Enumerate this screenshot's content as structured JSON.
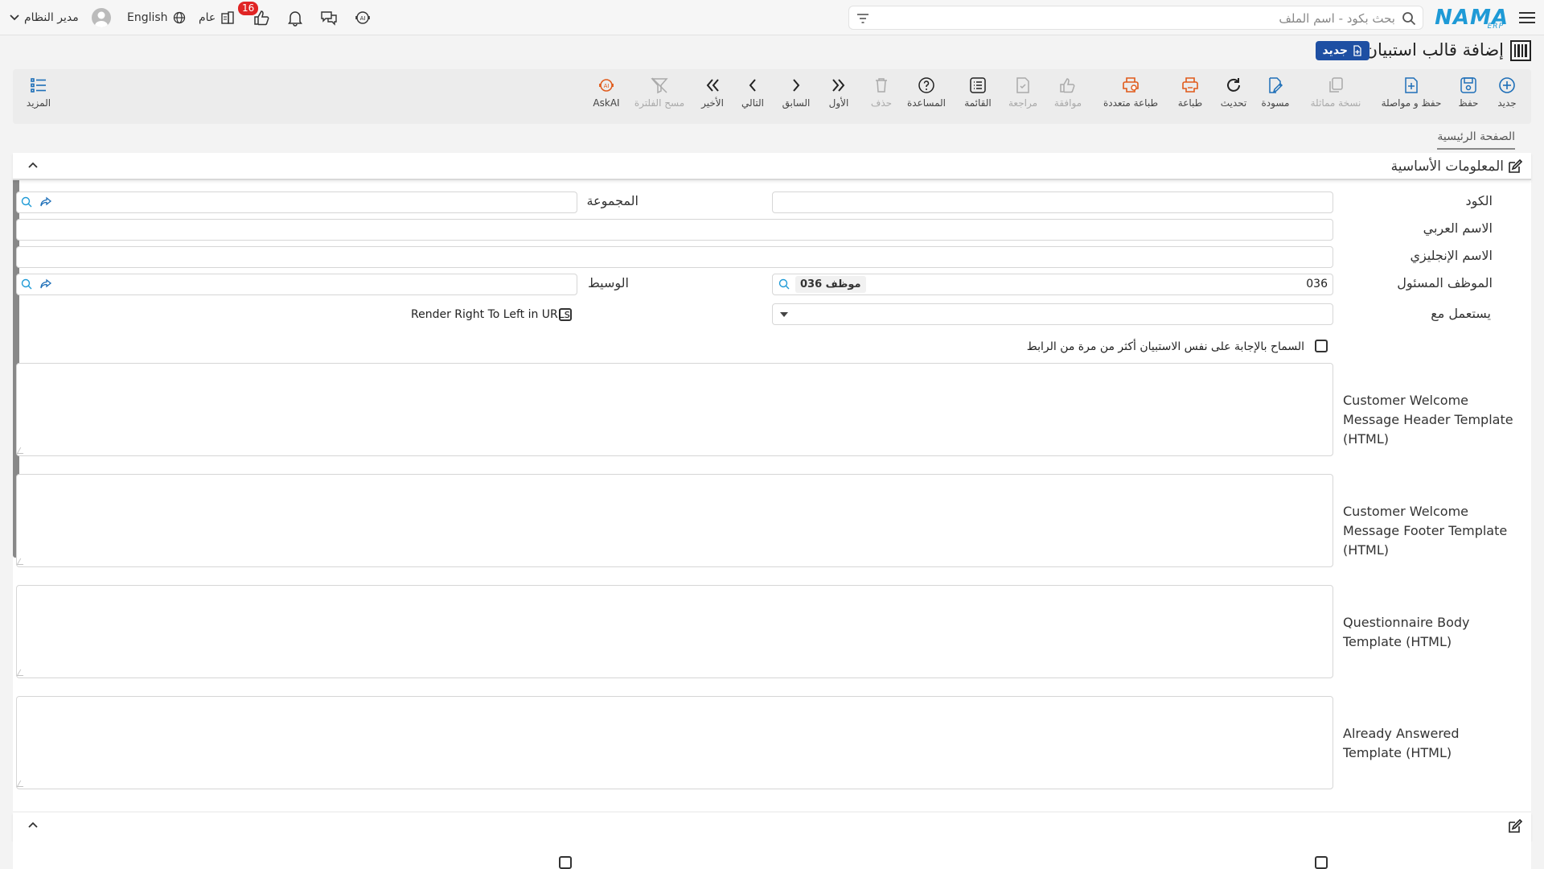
{
  "topbar": {
    "logo_text": "NAMA",
    "logo_sub": "ERP",
    "search_placeholder": "بحث بكود - اسم الملف",
    "language": "English",
    "user_name": "مدير النظام",
    "general_label": "عام",
    "notifications_count": "16"
  },
  "header": {
    "title": "إضافة قالب استبيان",
    "new_badge": "جديد"
  },
  "toolbar": {
    "items": [
      {
        "label": "جديد",
        "icon": "plus-circle-icon"
      },
      {
        "label": "حفظ",
        "icon": "save-icon"
      },
      {
        "label": "حفظ و مواصلة",
        "icon": "save-continue-icon"
      },
      {
        "label": "نسخة مماثلة",
        "icon": "copy-icon"
      },
      {
        "label": "مسودة",
        "icon": "draft-icon"
      },
      {
        "label": "تحديث",
        "icon": "refresh-icon"
      },
      {
        "label": "طباعة",
        "icon": "print-icon"
      },
      {
        "label": "طباعة متعددة",
        "icon": "multi-print-icon"
      },
      {
        "label": "موافقة",
        "icon": "approve-icon"
      },
      {
        "label": "مراجعة",
        "icon": "review-icon"
      },
      {
        "label": "القائمة",
        "icon": "list-icon"
      },
      {
        "label": "المساعدة",
        "icon": "help-icon"
      },
      {
        "label": "حذف",
        "icon": "trash-icon"
      },
      {
        "label": "الأول",
        "icon": "first-icon"
      },
      {
        "label": "السابق",
        "icon": "prev-icon"
      },
      {
        "label": "التالي",
        "icon": "next-icon"
      },
      {
        "label": "الأخير",
        "icon": "last-icon"
      },
      {
        "label": "مسح الفلترة",
        "icon": "clear-filter-icon"
      },
      {
        "label": "AskAI",
        "icon": "ai-icon"
      }
    ],
    "more_label": "المزيد"
  },
  "tabs": {
    "main": "الصفحة الرئيسية"
  },
  "basic_info": {
    "section_title": "المعلومات الأساسية",
    "code_label": "الكود",
    "code_value": "",
    "group_label": "المجموعة",
    "group_value": "",
    "arabic_name_label": "الاسم العربي",
    "english_name_label": "الاسم الإنجليزي",
    "responsible_label": "الموظف المسئول",
    "responsible_code": "036",
    "responsible_name": "موظف 036",
    "mediator_label": "الوسيط",
    "used_with_label": "يستعمل مع",
    "rtl_urls_label": "Render Right To Left in URLs",
    "allow_multi_label": "السماح بالإجابة على نفس الاستبيان أكثر من مرة من الرابط",
    "header_template_label": "Customer Welcome Message Header Template (HTML)",
    "footer_template_label": "Customer Welcome Message Footer Template (HTML)",
    "body_template_label": "Questionnaire Body Template (HTML)",
    "answered_template_label": "Already Answered Template (HTML)"
  }
}
